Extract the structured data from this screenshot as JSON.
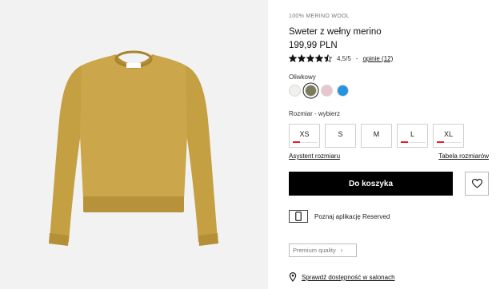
{
  "product": {
    "material": "100% MERINO WOOL",
    "title": "Sweter z wełny merino",
    "price": "199,99 PLN",
    "rating_value": 4.5,
    "rating_text": "4,5/5",
    "rating_separator": "-",
    "reviews_link": "opinie (12)"
  },
  "color": {
    "label": "Oliwkowy",
    "swatches": [
      {
        "name": "white",
        "hex": "#f0f0ec",
        "selected": false
      },
      {
        "name": "olive",
        "hex": "#7b7b5a",
        "selected": true
      },
      {
        "name": "pink",
        "hex": "#e7c7cd",
        "selected": false
      },
      {
        "name": "blue",
        "hex": "#2494e0",
        "selected": false
      }
    ]
  },
  "size": {
    "label": "Rozmiar -  wybierz",
    "options": [
      {
        "label": "XS",
        "low_stock": true
      },
      {
        "label": "S",
        "low_stock": false
      },
      {
        "label": "M",
        "low_stock": false
      },
      {
        "label": "L",
        "low_stock": true
      },
      {
        "label": "XL",
        "low_stock": true
      }
    ],
    "assistant_link": "Asystent rozmiaru",
    "table_link": "Tabela rozmiarów"
  },
  "actions": {
    "add_to_cart": "Do koszyka",
    "favorite_icon": "heart-icon"
  },
  "app_promo": {
    "icon": "phone-icon",
    "text": "Poznaj aplikację Reserved"
  },
  "premium": {
    "label": "Premium quality",
    "chevron": "›"
  },
  "store": {
    "icon": "map-pin-icon",
    "text": "Sprawdź dostępność w salonach"
  },
  "colors": {
    "sweater": "#c9a448",
    "sweater_dark": "#b18d36",
    "accent_black": "#000000",
    "low_stock_red": "#e41e26"
  }
}
